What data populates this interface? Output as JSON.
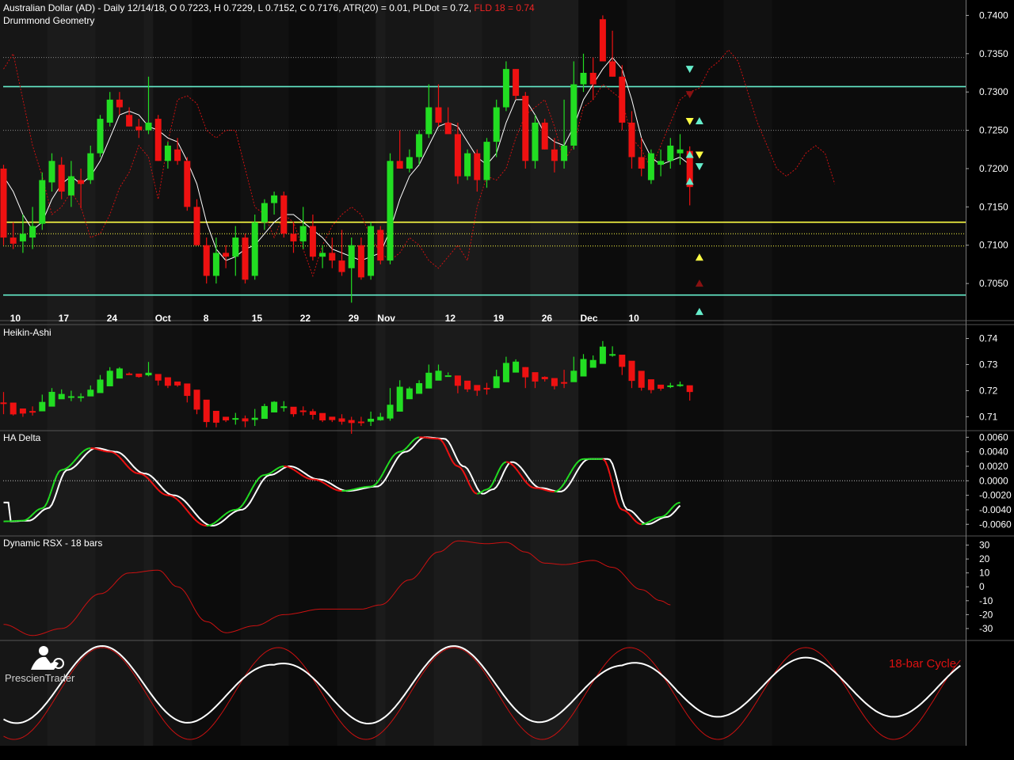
{
  "header": {
    "title": "Australian Dollar (AD) - Daily 12/14/18, O 0.7223, H 0.7229, L 0.7152, C 0.7176, ATR(20) = 0.01, PLDot = 0.72,",
    "fld": "FLD 18 = 0.74"
  },
  "brand": {
    "name": "PrescienTrader"
  },
  "colors": {
    "up": "#22dd22",
    "down": "#ee1111",
    "fld": "#cc1111",
    "cyan_line": "#66eecc",
    "yellow_line": "#ffff44"
  },
  "chart_data": [
    {
      "type": "candlestick",
      "label": "Drummond Geometry",
      "ylim": [
        0.7015,
        0.7418
      ],
      "yticks": [
        "0.7400",
        "0.7350",
        "0.7300",
        "0.7250",
        "0.7200",
        "0.7150",
        "0.7100",
        "0.7050"
      ],
      "x_labels": [
        {
          "i": 1,
          "text": "10"
        },
        {
          "i": 6,
          "text": "17"
        },
        {
          "i": 11,
          "text": "24"
        },
        {
          "i": 16,
          "text": "Oct"
        },
        {
          "i": 21,
          "text": "8"
        },
        {
          "i": 26,
          "text": "15"
        },
        {
          "i": 31,
          "text": "22"
        },
        {
          "i": 36,
          "text": "29"
        },
        {
          "i": 39,
          "text": "Nov"
        },
        {
          "i": 46,
          "text": "12"
        },
        {
          "i": 51,
          "text": "19"
        },
        {
          "i": 56,
          "text": "26"
        },
        {
          "i": 60,
          "text": "Dec"
        },
        {
          "i": 65,
          "text": "10"
        }
      ],
      "candles": [
        [
          0.72,
          0.7205,
          0.71,
          0.711
        ],
        [
          0.711,
          0.713,
          0.7095,
          0.7102
        ],
        [
          0.7105,
          0.714,
          0.709,
          0.7115
        ],
        [
          0.711,
          0.715,
          0.7095,
          0.7125
        ],
        [
          0.7128,
          0.7195,
          0.712,
          0.7185
        ],
        [
          0.7182,
          0.722,
          0.717,
          0.721
        ],
        [
          0.7205,
          0.7215,
          0.716,
          0.717
        ],
        [
          0.7165,
          0.721,
          0.715,
          0.719
        ],
        [
          0.7185,
          0.72,
          0.7148,
          0.718
        ],
        [
          0.7185,
          0.723,
          0.718,
          0.722
        ],
        [
          0.722,
          0.727,
          0.7215,
          0.7265
        ],
        [
          0.726,
          0.73,
          0.7255,
          0.729
        ],
        [
          0.729,
          0.73,
          0.727,
          0.728
        ],
        [
          0.727,
          0.728,
          0.7255,
          0.7255
        ],
        [
          0.7255,
          0.7265,
          0.724,
          0.725
        ],
        [
          0.725,
          0.732,
          0.7245,
          0.726
        ],
        [
          0.7265,
          0.727,
          0.721,
          0.721
        ],
        [
          0.721,
          0.7235,
          0.72,
          0.723
        ],
        [
          0.7225,
          0.724,
          0.7205,
          0.721
        ],
        [
          0.721,
          0.7215,
          0.7145,
          0.715
        ],
        [
          0.715,
          0.716,
          0.71,
          0.71
        ],
        [
          0.71,
          0.711,
          0.705,
          0.706
        ],
        [
          0.706,
          0.711,
          0.705,
          0.709
        ],
        [
          0.709,
          0.71,
          0.707,
          0.7085
        ],
        [
          0.7085,
          0.7125,
          0.706,
          0.711
        ],
        [
          0.711,
          0.7115,
          0.705,
          0.7055
        ],
        [
          0.706,
          0.714,
          0.7055,
          0.713
        ],
        [
          0.713,
          0.716,
          0.712,
          0.7155
        ],
        [
          0.7155,
          0.717,
          0.714,
          0.7165
        ],
        [
          0.7165,
          0.717,
          0.711,
          0.7115
        ],
        [
          0.7115,
          0.713,
          0.709,
          0.7105
        ],
        [
          0.7105,
          0.715,
          0.7095,
          0.7125
        ],
        [
          0.7125,
          0.714,
          0.708,
          0.7085
        ],
        [
          0.7085,
          0.71,
          0.707,
          0.709
        ],
        [
          0.709,
          0.711,
          0.707,
          0.708
        ],
        [
          0.708,
          0.712,
          0.706,
          0.7065
        ],
        [
          0.707,
          0.711,
          0.7025,
          0.71
        ],
        [
          0.71,
          0.711,
          0.7055,
          0.7058
        ],
        [
          0.706,
          0.713,
          0.7055,
          0.7125
        ],
        [
          0.712,
          0.7125,
          0.7075,
          0.708
        ],
        [
          0.708,
          0.722,
          0.7075,
          0.721
        ],
        [
          0.721,
          0.725,
          0.72,
          0.72
        ],
        [
          0.72,
          0.7225,
          0.7195,
          0.7215
        ],
        [
          0.7215,
          0.725,
          0.7205,
          0.7245
        ],
        [
          0.7245,
          0.731,
          0.724,
          0.728
        ],
        [
          0.728,
          0.731,
          0.7255,
          0.726
        ],
        [
          0.726,
          0.728,
          0.725,
          0.7245
        ],
        [
          0.7245,
          0.726,
          0.718,
          0.719
        ],
        [
          0.719,
          0.7225,
          0.7185,
          0.722
        ],
        [
          0.722,
          0.7225,
          0.717,
          0.7185
        ],
        [
          0.7185,
          0.724,
          0.7175,
          0.7235
        ],
        [
          0.7235,
          0.729,
          0.7215,
          0.728
        ],
        [
          0.728,
          0.734,
          0.7275,
          0.733
        ],
        [
          0.733,
          0.733,
          0.729,
          0.7295
        ],
        [
          0.7295,
          0.73,
          0.72,
          0.721
        ],
        [
          0.721,
          0.727,
          0.72,
          0.726
        ],
        [
          0.726,
          0.7265,
          0.7225,
          0.7225
        ],
        [
          0.7225,
          0.724,
          0.7195,
          0.721
        ],
        [
          0.721,
          0.729,
          0.72,
          0.723
        ],
        [
          0.723,
          0.734,
          0.7225,
          0.731
        ],
        [
          0.731,
          0.735,
          0.73,
          0.7325
        ],
        [
          0.7325,
          0.7345,
          0.729,
          0.731
        ],
        [
          0.7395,
          0.74,
          0.734,
          0.734
        ],
        [
          0.734,
          0.738,
          0.732,
          0.732
        ],
        [
          0.732,
          0.7335,
          0.725,
          0.726
        ],
        [
          0.726,
          0.7275,
          0.72,
          0.7215
        ],
        [
          0.7215,
          0.724,
          0.719,
          0.72
        ],
        [
          0.7185,
          0.7225,
          0.718,
          0.722
        ],
        [
          0.7205,
          0.7225,
          0.719,
          0.721
        ],
        [
          0.721,
          0.724,
          0.72,
          0.723
        ],
        [
          0.722,
          0.7245,
          0.7205,
          0.7225
        ],
        [
          0.7223,
          0.7229,
          0.7152,
          0.7176
        ]
      ],
      "hlines": [
        {
          "y": 0.7307,
          "color": "#66eecc",
          "style": "solid"
        },
        {
          "y": 0.7035,
          "color": "#66eecc",
          "style": "solid"
        },
        {
          "y": 0.713,
          "color": "#ffff44",
          "style": "solid"
        },
        {
          "y": 0.7115,
          "color": "#ffff44",
          "style": "dotted"
        },
        {
          "y": 0.7099,
          "color": "#ffff44",
          "style": "dotted"
        },
        {
          "y": 0.7345,
          "color": "#888888",
          "style": "dotted"
        },
        {
          "y": 0.725,
          "color": "#888888",
          "style": "dotted"
        }
      ],
      "pldot": [
        0.719,
        0.717,
        0.714,
        0.712,
        0.713,
        0.716,
        0.718,
        0.719,
        0.718,
        0.719,
        0.721,
        0.724,
        0.727,
        0.7275,
        0.727,
        0.7255,
        0.725,
        0.724,
        0.7235,
        0.721,
        0.718,
        0.713,
        0.7095,
        0.708,
        0.7085,
        0.7095,
        0.71,
        0.7115,
        0.713,
        0.714,
        0.714,
        0.713,
        0.712,
        0.711,
        0.7095,
        0.709,
        0.7085,
        0.708,
        0.7085,
        0.709,
        0.712,
        0.716,
        0.719,
        0.7205,
        0.723,
        0.7255,
        0.726,
        0.7255,
        0.7235,
        0.7215,
        0.7205,
        0.722,
        0.726,
        0.729,
        0.729,
        0.727,
        0.7245,
        0.7235,
        0.723,
        0.7255,
        0.729,
        0.731,
        0.733,
        0.7345,
        0.733,
        0.729,
        0.724,
        0.7215,
        0.7205,
        0.721,
        0.7215,
        0.7205
      ],
      "fld": [
        0.733,
        0.735,
        0.729,
        0.723,
        0.719,
        0.714,
        0.715,
        0.717,
        0.715,
        0.711,
        0.7115,
        0.714,
        0.7175,
        0.7195,
        0.723,
        0.7215,
        0.716,
        0.7235,
        0.729,
        0.7295,
        0.7285,
        0.725,
        0.724,
        0.725,
        0.725,
        0.72,
        0.715,
        0.714,
        0.711,
        0.714,
        0.713,
        0.7095,
        0.706,
        0.71,
        0.7125,
        0.714,
        0.715,
        0.714,
        0.711,
        0.709,
        0.708,
        0.709,
        0.711,
        0.71,
        0.708,
        0.707,
        0.7085,
        0.71,
        0.708,
        0.715,
        0.719,
        0.7185,
        0.72,
        0.724,
        0.727,
        0.728,
        0.729,
        0.7255,
        0.721,
        0.723,
        0.728,
        0.729,
        0.731,
        0.73,
        0.729,
        0.724,
        0.7225,
        0.72,
        0.723,
        0.726,
        0.729,
        0.73,
        0.7305,
        0.733,
        0.734,
        0.7355,
        0.734,
        0.73,
        0.726,
        0.723,
        0.72,
        0.719,
        0.72,
        0.722,
        0.723,
        0.722,
        0.718
      ],
      "markers": [
        {
          "i": 71,
          "y": 0.733,
          "shape": "down",
          "color": "#66eecc"
        },
        {
          "i": 71,
          "y": 0.7297,
          "shape": "down",
          "color": "#881111"
        },
        {
          "i": 71,
          "y": 0.7262,
          "shape": "down",
          "color": "#ffff44"
        },
        {
          "i": 72,
          "y": 0.7262,
          "shape": "up",
          "color": "#66eecc"
        },
        {
          "i": 71,
          "y": 0.7218,
          "shape": "up",
          "color": "#66eecc"
        },
        {
          "i": 72,
          "y": 0.7218,
          "shape": "down",
          "color": "#ffff44"
        },
        {
          "i": 72,
          "y": 0.7203,
          "shape": "down",
          "color": "#66eecc"
        },
        {
          "i": 71,
          "y": 0.7183,
          "shape": "up",
          "color": "#66eecc"
        },
        {
          "i": 72,
          "y": 0.7084,
          "shape": "up",
          "color": "#ffff44"
        },
        {
          "i": 72,
          "y": 0.705,
          "shape": "up",
          "color": "#881111"
        },
        {
          "i": 72,
          "y": 0.7013,
          "shape": "up",
          "color": "#66eecc"
        }
      ]
    },
    {
      "type": "candlestick",
      "label": "Heikin-Ashi",
      "ylim": [
        0.705,
        0.745
      ],
      "yticks": [
        "0.74",
        "0.73",
        "0.72",
        "0.71"
      ]
    },
    {
      "type": "line",
      "label": "HA Delta",
      "ylim": [
        -0.0075,
        0.0068
      ],
      "yticks": [
        "0.0060",
        "0.0040",
        "0.0020",
        "0.0000",
        "-0.0020",
        "-0.0040",
        "-0.0060"
      ]
    },
    {
      "type": "line",
      "label": "Dynamic RSX - 18 bars",
      "ylim": [
        -38,
        36
      ],
      "yticks": [
        "30",
        "20",
        "10",
        "0",
        "-10",
        "-20",
        "-30"
      ]
    },
    {
      "type": "line",
      "label": "18-bar Cycle",
      "series": [
        {
          "name": "18-bar Cycle",
          "color": "#cc1111"
        }
      ]
    }
  ]
}
